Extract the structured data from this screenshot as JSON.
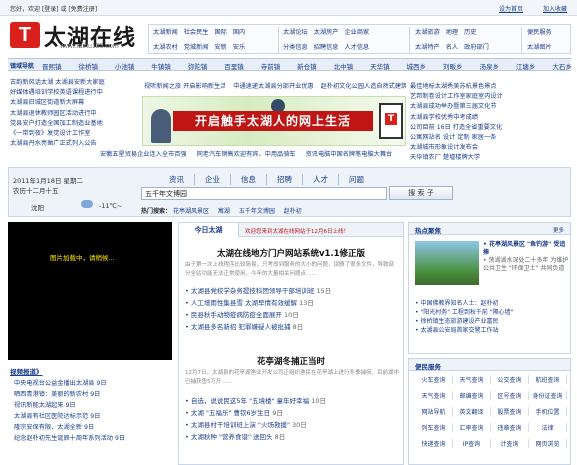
{
  "topbar": {
    "left": "您好，欢迎 [登录] 或 [免费注册]",
    "right": [
      "设为首页",
      "加入收藏"
    ]
  },
  "logo": {
    "mark": "T",
    "name": "太湖在线",
    "url": "www.taihu123.com"
  },
  "nav": {
    "group1": [
      "太湖新闻",
      "社会民生",
      "国际",
      "国内",
      "太湖农村",
      "党城新闻",
      "安新",
      "安乐"
    ],
    "group2": [
      "太湖论坛",
      "太湖房产",
      "企业商家",
      "分类信息",
      "招聘信息",
      "人才信息"
    ],
    "group3": [
      "太湖旅游",
      "地理",
      "历史",
      "太湖特产",
      "名人",
      "政府部门"
    ],
    "group4": [
      "便民服务",
      "太湖图片"
    ]
  },
  "townbar": {
    "label": "镇域导航",
    "items": [
      "晋熙镇",
      "徐桥镇",
      "小池镇",
      "牛镇镇",
      "弥陀镇",
      "百里镇",
      "寺前镇",
      "新仓镇",
      "北中镇",
      "天华镇",
      "城西乡",
      "刘畈乡",
      "汤泉乡",
      "江塘乡",
      "大石乡"
    ]
  },
  "left_news": [
    "古韵新风话太湖 太湖县安新大家庭",
    "好媒体遇培训学校英语课程进行中",
    "太湖县旧城区街道新大屏幕",
    "太湖县退休教师园区活动进行中",
    "党县安户打造全国加工制造业基地",
    "《一带到夜》发觉设计工作室",
    "太湖县丹水亮凿广正式列入公告"
  ],
  "mid_news": [
    "视听新闻之旅 开启影响新生活",
    "中通速递太湖县分部开业优惠",
    "赵朴初文化公园人造自然式建筑",
    "第二届中国·太湖世界文化节"
  ],
  "right_news": [
    "最佳地标太湖秀美苏杭景色景点",
    "艺邦制卷设计工作室家庭室内设计",
    "太湖县成功举办暨第三届文化节",
    "太湖县学校优秀中考成绩",
    "公司目前 16日 打造全省重要文化",
    "公寓网站名 设计 定制 家居一条",
    "太湖城市形象设计发布会",
    "天华镇农厂 楚墟楼牌大学"
  ],
  "banner": {
    "slogan": "开启触手太湖人的网上生活",
    "mark": "T"
  },
  "lower_row_news": [
    "安徽五星贸易企业连入全市百强",
    "同老汽车销售欢迎有宾、中用品骑车",
    "资讯电脑中国名牌笔电脑大舞台"
  ],
  "search": {
    "date": "2011年1月18日  星期二",
    "lunar": "农历十二月十五",
    "city": "沈阳",
    "temp": "-11℃~",
    "categories": [
      "资讯",
      "企业",
      "信息",
      "招聘",
      "人才",
      "问题"
    ],
    "value": "五千年文博园",
    "button": "搜 索 子",
    "hot_label": "热门搜索：",
    "hot": [
      "花亭湖风景区",
      "寓湖",
      "五千年文博园",
      "赵朴初"
    ]
  },
  "video": {
    "message": "图片加载中，请稍候..."
  },
  "side_list": {
    "title": "视频报道》",
    "items": [
      "中央电视台公益金播出太湖县  9日",
      "晒西青港镇：美丽的新农村  9日",
      "视讯新能太湖起来  9日",
      "太湖县有社区医院达标示范  9日",
      "隆宗安保有限、太湖全新  9日",
      "纪念赵朴初先生诞辰十周年系列活动  9日"
    ]
  },
  "center": {
    "tab": "今日太湖",
    "scroll_notice": "欢迎您来到太湖在线网站于12月6日上线！",
    "headline1": "太湖在线地方门户网站系统v1.1修正版",
    "summary1": "由于第一次上线程序比较简易，只考虑到服务的大小的问题，误删了很多文件，导致部分全站功能无法正常使用，今年的大量相关问题点……",
    "list1": [
      [
        "太湖县党校学杂务提技科团领导干部培训班",
        "15日"
      ],
      [
        "人工增雨性集县雪  太湖早情有效缓解",
        "13日"
      ],
      [
        "民县秋手动物疫病防疫全面展开",
        "10日"
      ],
      [
        "太湖县多名新招 犯罪嫌疑人被批捕",
        "8日"
      ]
    ],
    "headline2": "花亭湖冬捕正当时",
    "summary2": "12月7日，太湖县的花亭湖渔业开发公司正组织渔民在花亭湖上进行冬季捕捞，目前湖中已捕获鱼5万斤……",
    "list2": [
      [
        "自选，说说民这5年 \"五境楼\" 童年好幸福",
        "10日"
      ],
      [
        "太湖 \"五福乐\" 曹钦6岁生日",
        "9日"
      ],
      [
        "太湖县村干培训班上演 \"火场救援\"",
        "30日"
      ],
      [
        "太湖秋种 \"营养食谱\" 送回头",
        "8日"
      ]
    ]
  },
  "hot": {
    "title": "热点聚焦",
    "more": "更多",
    "items": [
      "花亭湖风景区 \"鱼钓游\" 受追捧",
      "荡湖湖水深处二十多年 为维护公共卫生 \"环保卫士\" 共同负道",
      "中国佛教界知名人士：赵朴初",
      "\"阳光村务\" 工程到秋千前 \"隔心墙\"",
      "徐桥镇生态旅游建设产业富民",
      "太湖县公安局首家交警工作站"
    ]
  },
  "service": {
    "title": "便民服务",
    "items": [
      "火车查询",
      "天气查询",
      "公交查询",
      "航班查询",
      "天气查询",
      "邮编查询",
      "区号查询",
      "身份证查询",
      "网站导航",
      "英文翻译",
      "股票查询",
      "手机位置",
      "列车查询",
      "汇率查询",
      "违章查询",
      "法律",
      "快递查询",
      "IP查询",
      "计查询",
      "网页浏览"
    ]
  }
}
